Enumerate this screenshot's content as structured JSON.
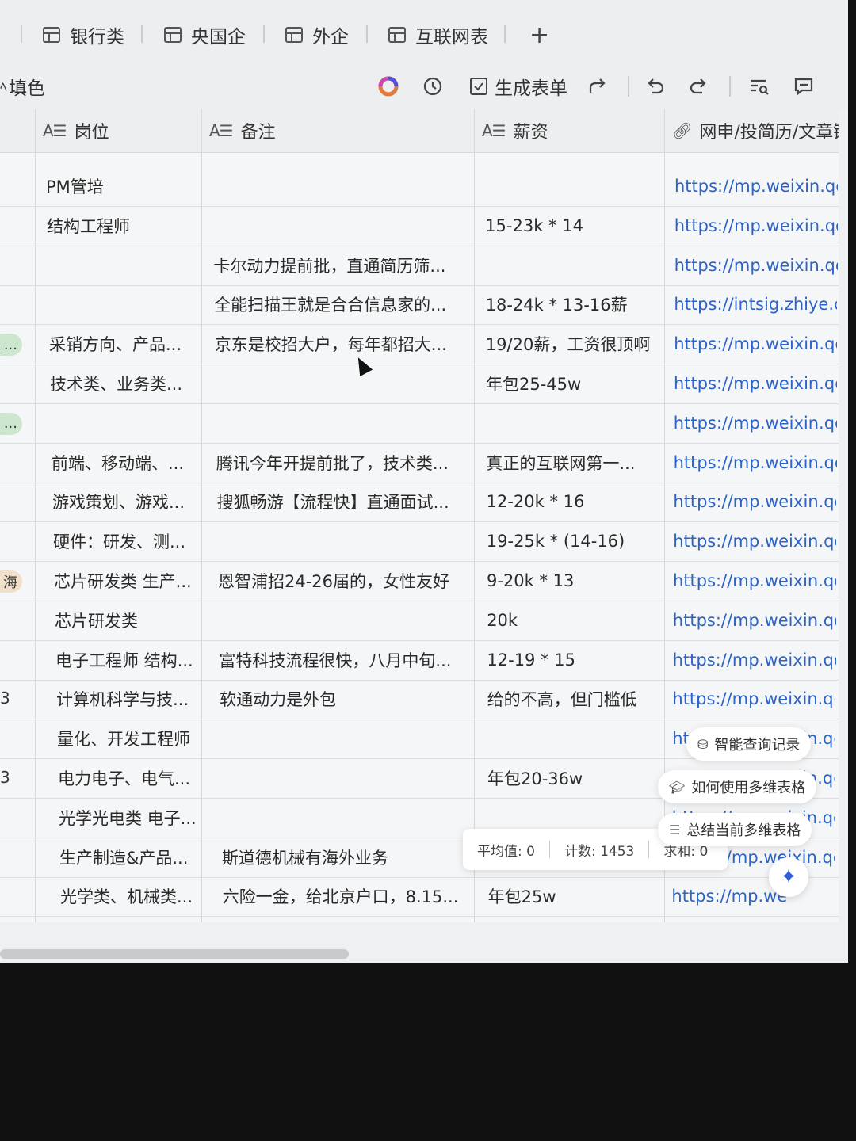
{
  "tabs": [
    {
      "label": "银行类"
    },
    {
      "label": "央国企"
    },
    {
      "label": "外企"
    },
    {
      "label": "互联网表"
    }
  ],
  "tab_add": "+",
  "toolbar": {
    "fill_color": "填色",
    "generate_form": "生成表单"
  },
  "columns": [
    "岗位",
    "备注",
    "薪资",
    "网申/投简历/文章链"
  ],
  "rows": [
    {
      "left": "",
      "position": "PM管培",
      "note": "",
      "salary": "",
      "link": "https://mp.weixin.qq."
    },
    {
      "left": "",
      "position": "结构工程师",
      "note": "",
      "salary": "15-23k * 14",
      "link": "https://mp.weixin.qq."
    },
    {
      "left": "",
      "position": "",
      "note": "卡尔动力提前批，直通简历筛...",
      "salary": "",
      "link": "https://mp.weixin.qq."
    },
    {
      "left": "",
      "position": "",
      "note": "全能扫描王就是合合信息家的...",
      "salary": "18-24k * 13-16薪",
      "link": "https://intsig.zhiye.c"
    },
    {
      "left": "...",
      "position": "采销方向、产品...",
      "note": "京东是校招大户，每年都招大...",
      "salary": "19/20薪，工资很顶啊",
      "link": "https://mp.weixin.qq."
    },
    {
      "left": "",
      "position": "技术类、业务类...",
      "note": "",
      "salary": "年包25-45w",
      "link": "https://mp.weixin.qq."
    },
    {
      "left": "...",
      "position": "",
      "note": "",
      "salary": "",
      "link": "https://mp.weixin.qq."
    },
    {
      "left": "",
      "position": "前端、移动端、...",
      "note": "腾讯今年开提前批了，技术类...",
      "salary": "真正的互联网第一...",
      "link": "https://mp.weixin.qq."
    },
    {
      "left": "",
      "position": "游戏策划、游戏...",
      "note": "搜狐畅游【流程快】直通面试...",
      "salary": "12-20k * 16",
      "link": "https://mp.weixin.qq."
    },
    {
      "left": "",
      "position": "硬件：研发、测...",
      "note": "",
      "salary": "19-25k * (14-16)",
      "link": "https://mp.weixin.qq."
    },
    {
      "left": "海",
      "position": "芯片研发类 生产...",
      "note": "恩智浦招24-26届的，女性友好",
      "salary": "9-20k * 13",
      "link": "https://mp.weixin.qq."
    },
    {
      "left": "",
      "position": "芯片研发类",
      "note": "",
      "salary": "20k",
      "link": "https://mp.weixin.qq."
    },
    {
      "left": "",
      "position": "电子工程师 结构...",
      "note": "富特科技流程很快，八月中旬...",
      "salary": "12-19 * 15",
      "link": "https://mp.weixin.qq."
    },
    {
      "left": "3",
      "position": "计算机科学与技...",
      "note": "软通动力是外包",
      "salary": "给的不高，但门槛低",
      "link": "https://mp.weixin.qq."
    },
    {
      "left": "",
      "position": "量化、开发工程师",
      "note": "",
      "salary": "",
      "link": "https://mp.weixin.qq."
    },
    {
      "left": "3",
      "position": "电力电子、电气...",
      "note": "",
      "salary": "年包20-36w",
      "link": "https://mp.weixin.qq."
    },
    {
      "left": "",
      "position": "光学光电类 电子...",
      "note": "",
      "salary": "",
      "link": "https://mp.weixin.qq."
    },
    {
      "left": "",
      "position": "生产制造&产品...",
      "note": "斯道德机械有海外业务",
      "salary": "",
      "link": "https://mp.weixin.qq."
    },
    {
      "left": "",
      "position": "光学类、机械类...",
      "note": "六险一金，给北京户口，8.15...",
      "salary": "年包25w",
      "link": "https://mp.we"
    }
  ],
  "stats": {
    "avg": "平均值: 0",
    "count": "计数: 1453",
    "sum": "求和: 0"
  },
  "ai_menu": [
    {
      "label": "智能查询记录"
    },
    {
      "label": "如何使用多维表格"
    },
    {
      "label": "总结当前多维表格"
    }
  ],
  "icons": {
    "table": "table-icon",
    "fab": "sparkle-icon"
  }
}
